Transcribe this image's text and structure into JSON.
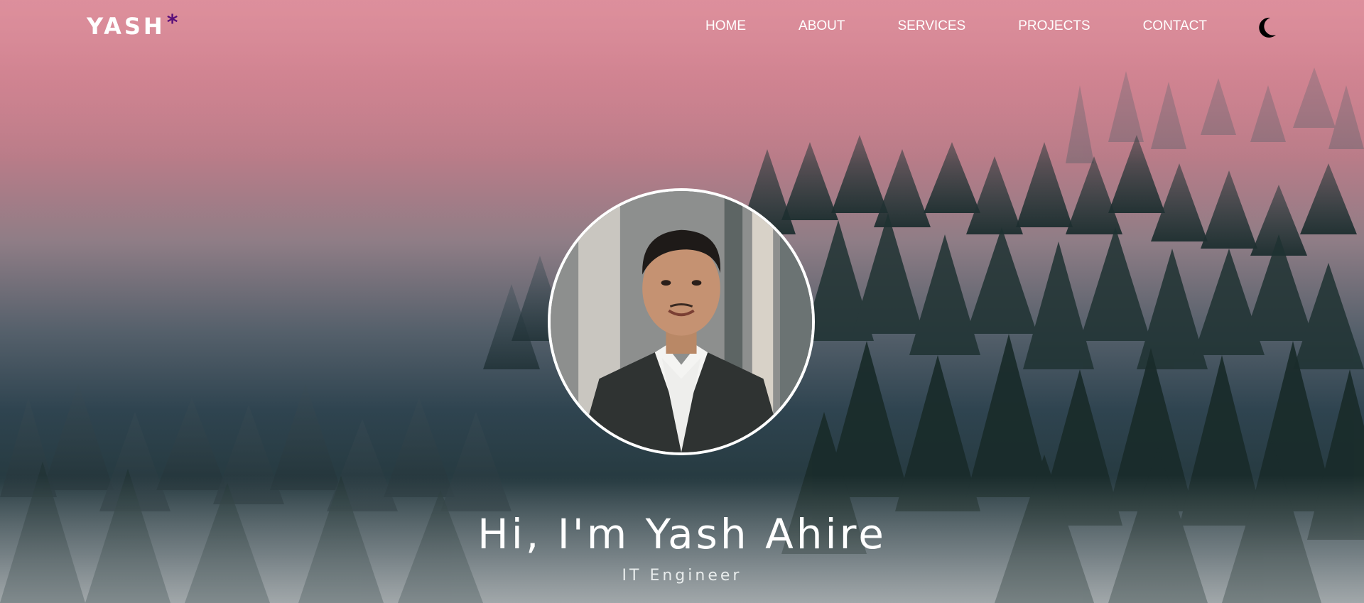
{
  "brand": {
    "name": "YASH",
    "mark": "*"
  },
  "nav": {
    "items": [
      {
        "label": "HOME"
      },
      {
        "label": "ABOUT"
      },
      {
        "label": "SERVICES"
      },
      {
        "label": "PROJECTS"
      },
      {
        "label": "CONTACT"
      }
    ],
    "theme_toggle_icon": "moon-icon"
  },
  "hero": {
    "headline": "Hi, I'm Yash Ahire",
    "role": "IT Engineer",
    "avatar": "profile-photo"
  },
  "colors": {
    "brand_mark": "#5a0f7a",
    "sky_top": "#dd8f9c",
    "forest": "#263a40",
    "text": "#ffffff"
  }
}
